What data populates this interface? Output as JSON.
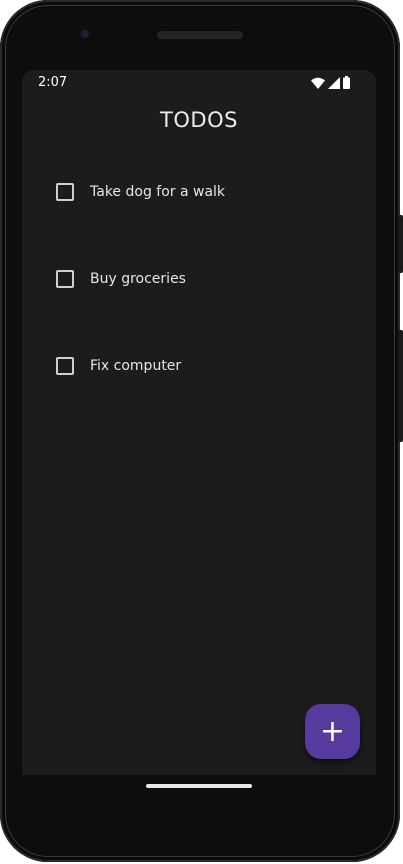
{
  "status_bar": {
    "time": "2:07",
    "icons": [
      "wifi-icon",
      "cellular-signal-icon",
      "battery-icon"
    ]
  },
  "app": {
    "title": "TODOS"
  },
  "todos": [
    {
      "label": "Take dog for a walk",
      "checked": false
    },
    {
      "label": "Buy groceries",
      "checked": false
    },
    {
      "label": "Fix computer",
      "checked": false
    }
  ],
  "fab": {
    "label": "+",
    "icon": "plus-icon"
  },
  "colors": {
    "background": "#1c1c1c",
    "fab": "#573a9e",
    "text": "#e6e6e6"
  }
}
